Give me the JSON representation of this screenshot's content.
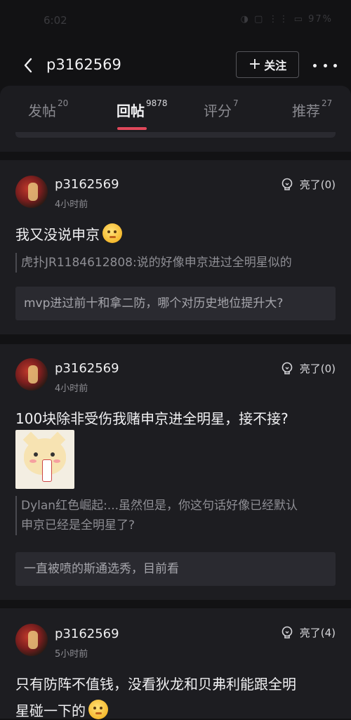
{
  "status_bar": {
    "time": "6:02",
    "icons": "◑ ▢ ⋮⋮ ▭ 97%"
  },
  "header": {
    "back_icon": "chevron-left-icon",
    "title": "p3162569",
    "follow_label": "关注",
    "more_icon": "more-dots-icon"
  },
  "tabs": [
    {
      "label": "发帖",
      "count": "20"
    },
    {
      "label": "回帖",
      "count": "9878",
      "active": true
    },
    {
      "label": "评分",
      "count": "7"
    },
    {
      "label": "推荐",
      "count": "27"
    }
  ],
  "accent_color": "#e0485a",
  "posts": [
    {
      "username": "p3162569",
      "time": "4小时前",
      "like_label": "亮了(0)",
      "content": "我又没说申京",
      "quote": "虎扑JR1184612808:说的好像申京进过全明星似的",
      "reply_title": "mvp进过前十和拿二防，哪个对历史地位提升大?"
    },
    {
      "username": "p3162569",
      "time": "4小时前",
      "like_label": "亮了(0)",
      "content": "100块除非受伤我赌申京进全明星，接不接?",
      "quote_line1": "Dylan红色崛起:...虽然但是，你这句话好像已经默认",
      "quote_line2": "申京已经是全明星了?",
      "reply_title": "一直被喷的斯通选秀，目前看"
    },
    {
      "username": "p3162569",
      "time": "5小时前",
      "like_label": "亮了(4)",
      "content_line1": "只有防阵不值钱，没看狄龙和贝弗利能跟全明",
      "content_line2": "星碰一下的"
    }
  ]
}
